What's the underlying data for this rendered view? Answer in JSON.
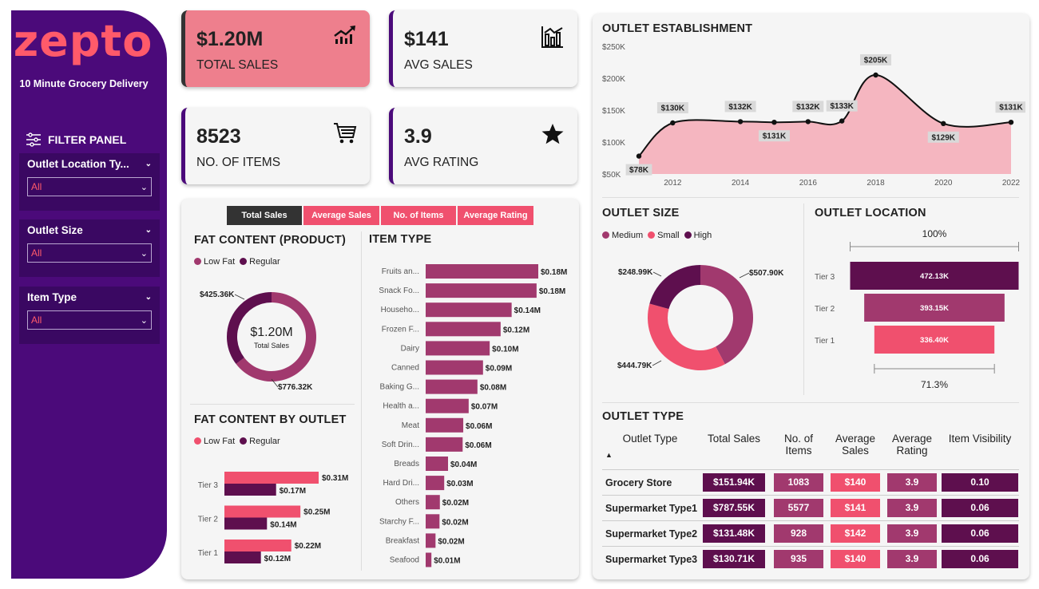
{
  "brand": {
    "logo": "zepto",
    "tagline": "10 Minute Grocery Delivery"
  },
  "filters": {
    "title": "FILTER PANEL",
    "items": [
      {
        "label": "Outlet Location Ty...",
        "value": "All"
      },
      {
        "label": "Outlet Size",
        "value": "All"
      },
      {
        "label": "Item Type",
        "value": "All"
      }
    ]
  },
  "kpis": {
    "total_sales": {
      "value": "$1.20M",
      "label": "TOTAL SALES"
    },
    "avg_sales": {
      "value": "$141",
      "label": "AVG SALES"
    },
    "items": {
      "value": "8523",
      "label": "NO. OF ITEMS"
    },
    "rating": {
      "value": "3.9",
      "label": "AVG RATING"
    }
  },
  "tabs": [
    "Total Sales",
    "Average Sales",
    "No. of Items",
    "Average Rating"
  ],
  "colors": {
    "purple_dark": "#4b0a7a",
    "plum": "#5e0f4e",
    "berry": "#a1396e",
    "coral": "#f0506e",
    "pink_fill": "#f5b6c0",
    "highlight": "#ee7f8d"
  },
  "sections": {
    "fat_content": "FAT CONTENT (PRODUCT)",
    "item_type": "ITEM TYPE",
    "fat_by_outlet": "FAT CONTENT BY OUTLET",
    "establishment": "OUTLET ESTABLISHMENT",
    "outlet_size": "OUTLET SIZE",
    "outlet_location": "OUTLET LOCATION",
    "outlet_type": "OUTLET TYPE"
  },
  "chart_data": [
    {
      "id": "fat_content",
      "type": "pie",
      "title": "FAT CONTENT (PRODUCT)",
      "center_value": "$1.20M",
      "center_label": "Total Sales",
      "categories": [
        "Low Fat",
        "Regular"
      ],
      "values": [
        776.32,
        425.36
      ],
      "labels": [
        "$776.32K",
        "$425.36K"
      ]
    },
    {
      "id": "item_type",
      "type": "bar",
      "title": "ITEM TYPE",
      "categories": [
        "Fruits an...",
        "Snack Fo...",
        "Househo...",
        "Frozen F...",
        "Dairy",
        "Canned",
        "Baking G...",
        "Health a...",
        "Meat",
        "Soft Drin...",
        "Breads",
        "Hard Dri...",
        "Others",
        "Starchy F...",
        "Breakfast",
        "Seafood"
      ],
      "values": [
        0.18,
        0.18,
        0.14,
        0.12,
        0.1,
        0.09,
        0.08,
        0.07,
        0.06,
        0.06,
        0.04,
        0.03,
        0.02,
        0.02,
        0.02,
        0.01
      ],
      "raw_values": [
        178.12,
        175.43,
        135.98,
        118.56,
        101.28,
        90.71,
        81.89,
        68.03,
        59.45,
        58.51,
        35.38,
        29.33,
        22.45,
        21.88,
        15.6,
        9.08
      ],
      "labels": [
        "$0.18M",
        "$0.18M",
        "$0.14M",
        "$0.12M",
        "$0.10M",
        "$0.09M",
        "$0.08M",
        "$0.07M",
        "$0.06M",
        "$0.06M",
        "$0.04M",
        "$0.03M",
        "$0.02M",
        "$0.02M",
        "$0.02M",
        "$0.01M"
      ]
    },
    {
      "id": "fat_by_outlet",
      "type": "bar",
      "title": "FAT CONTENT BY OUTLET",
      "categories": [
        "Tier 3",
        "Tier 2",
        "Tier 1"
      ],
      "series": [
        {
          "name": "Low Fat",
          "values": [
            0.31,
            0.25,
            0.22
          ],
          "labels": [
            "$0.31M",
            "$0.25M",
            "$0.22M"
          ]
        },
        {
          "name": "Regular",
          "values": [
            0.17,
            0.14,
            0.12
          ],
          "labels": [
            "$0.17M",
            "$0.14M",
            "$0.12M"
          ]
        }
      ]
    },
    {
      "id": "establishment",
      "type": "area",
      "title": "OUTLET ESTABLISHMENT",
      "x": [
        2011,
        2012,
        2014,
        2015,
        2016,
        2017,
        2018,
        2020,
        2022
      ],
      "values": [
        78,
        130,
        132,
        131,
        132,
        133,
        205,
        129,
        131
      ],
      "labels": [
        "$78K",
        "$130K",
        "$132K",
        "$131K",
        "$132K",
        "$133K",
        "$205K",
        "$129K",
        "$131K"
      ],
      "x_ticks": [
        "2012",
        "2014",
        "2016",
        "2018",
        "2020",
        "2022"
      ],
      "y_ticks": [
        "$50K",
        "$100K",
        "$150K",
        "$200K",
        "$250K"
      ],
      "ylim": [
        50,
        250
      ]
    },
    {
      "id": "outlet_size",
      "type": "pie",
      "title": "OUTLET SIZE",
      "categories": [
        "Medium",
        "Small",
        "High"
      ],
      "values": [
        507.9,
        444.79,
        248.99
      ],
      "labels": [
        "$507.90K",
        "$444.79K",
        "$248.99K"
      ]
    },
    {
      "id": "outlet_location",
      "type": "bar",
      "title": "OUTLET LOCATION",
      "categories": [
        "Tier 3",
        "Tier 2",
        "Tier 1"
      ],
      "values": [
        472.13,
        393.15,
        336.4
      ],
      "labels": [
        "472.13K",
        "393.15K",
        "336.40K"
      ],
      "top_label": "100%",
      "bottom_label": "71.3%"
    }
  ],
  "outlet_type": {
    "columns": [
      "Outlet Type",
      "Total Sales",
      "No. of Items",
      "Average Sales",
      "Average Rating",
      "Item Visibility"
    ],
    "rows": [
      {
        "name": "Grocery Store",
        "sales": "$151.94K",
        "items": "1083",
        "avg": "$140",
        "rating": "3.9",
        "vis": "0.10"
      },
      {
        "name": "Supermarket Type1",
        "sales": "$787.55K",
        "items": "5577",
        "avg": "$141",
        "rating": "3.9",
        "vis": "0.06"
      },
      {
        "name": "Supermarket Type2",
        "sales": "$131.48K",
        "items": "928",
        "avg": "$142",
        "rating": "3.9",
        "vis": "0.06"
      },
      {
        "name": "Supermarket Type3",
        "sales": "$130.71K",
        "items": "935",
        "avg": "$140",
        "rating": "3.9",
        "vis": "0.06"
      }
    ]
  }
}
